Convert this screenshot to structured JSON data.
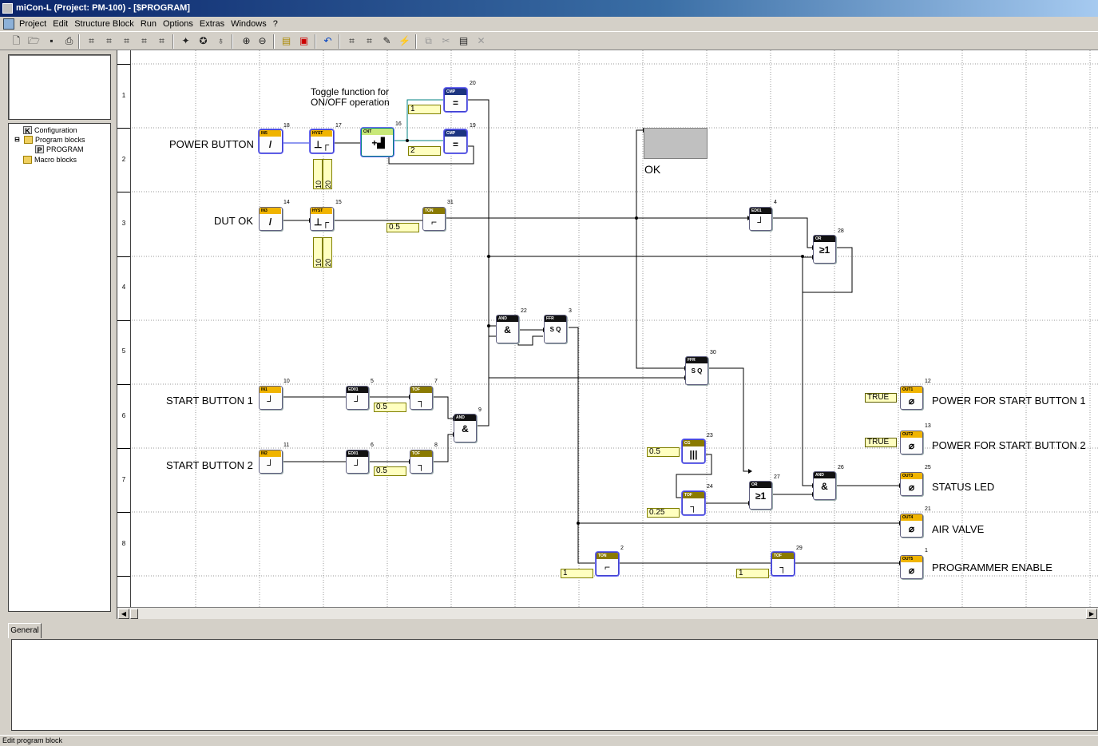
{
  "window": {
    "title": "miCon-L  (Project: PM-100)  - [$PROGRAM]"
  },
  "menu": [
    "Project",
    "Edit",
    "Structure Block",
    "Run",
    "Options",
    "Extras",
    "Windows",
    "?"
  ],
  "toolbar": {
    "icons": [
      "new-icon",
      "open-icon",
      "save-icon",
      "print-icon",
      "block-icon",
      "block-icon",
      "block-icon",
      "block-icon",
      "block-icon",
      "compile-icon",
      "download-icon",
      "bulb-icon",
      "zoom-in-icon",
      "zoom-out-icon",
      "cfg-icon",
      "stop-icon",
      "undo-icon",
      "select-icon",
      "link-icon",
      "pencil-icon",
      "wire-icon",
      "copy-icon",
      "cut-icon",
      "paste-icon",
      "delete-icon"
    ]
  },
  "tree": {
    "items": [
      {
        "label": "Configuration",
        "icon": "K"
      },
      {
        "label": "Program blocks",
        "icon": "folder"
      },
      {
        "label": "PROGRAM",
        "icon": "P"
      },
      {
        "label": "Macro blocks",
        "icon": "folder"
      }
    ]
  },
  "ruler": [
    "1",
    "2",
    "3",
    "4",
    "5",
    "6",
    "7",
    "8"
  ],
  "labels": {
    "toggle": "Toggle function for\nON/OFF operation",
    "power_button": "POWER BUTTON",
    "dut_ok": "DUT OK",
    "start1": "START BUTTON 1",
    "start2": "START BUTTON 2",
    "ok": "OK",
    "out1": "POWER FOR START BUTTON 1",
    "out2": "POWER FOR START BUTTON 2",
    "out3": "STATUS LED",
    "out4": "AIR VALVE",
    "out5": "PROGRAMMER ENABLE"
  },
  "blocks": [
    {
      "id": "in5",
      "type": "IN5",
      "num": "18",
      "sym": "/"
    },
    {
      "id": "hyst17",
      "type": "HYST",
      "num": "17",
      "sym": "⊥┌"
    },
    {
      "id": "cnt16",
      "type": "CNT",
      "num": "16",
      "sym": "+▟"
    },
    {
      "id": "cmp20",
      "type": "CMP",
      "num": "20",
      "sym": "="
    },
    {
      "id": "cmp19",
      "type": "CMP",
      "num": "19",
      "sym": "="
    },
    {
      "id": "in3",
      "type": "IN3",
      "num": "14",
      "sym": "/"
    },
    {
      "id": "hyst15",
      "type": "HYST",
      "num": "15",
      "sym": "⊥┌"
    },
    {
      "id": "ton31",
      "type": "TON",
      "num": "31",
      "sym": "⌐"
    },
    {
      "id": "ed4",
      "type": "ED01",
      "num": "4",
      "sym": "┘"
    },
    {
      "id": "or28",
      "type": "OR",
      "num": "28",
      "sym": "≥1"
    },
    {
      "id": "and22",
      "type": "AND",
      "num": "22",
      "sym": "&"
    },
    {
      "id": "ffr3",
      "type": "FFR",
      "num": "3",
      "sym": "S Q"
    },
    {
      "id": "ffr30",
      "type": "FFR",
      "num": "30",
      "sym": "S Q"
    },
    {
      "id": "in1",
      "type": "IN1",
      "num": "10",
      "sym": "┘"
    },
    {
      "id": "ed5",
      "type": "ED01",
      "num": "5",
      "sym": "┘"
    },
    {
      "id": "tof7",
      "type": "TOF",
      "num": "7",
      "sym": "┐"
    },
    {
      "id": "and9",
      "type": "AND",
      "num": "9",
      "sym": "&"
    },
    {
      "id": "in2",
      "type": "IN2",
      "num": "11",
      "sym": "┘"
    },
    {
      "id": "ed6",
      "type": "ED01",
      "num": "6",
      "sym": "┘"
    },
    {
      "id": "tof8",
      "type": "TOF",
      "num": "8",
      "sym": "┐"
    },
    {
      "id": "cg23",
      "type": "CG",
      "num": "23",
      "sym": "|||"
    },
    {
      "id": "tof24",
      "type": "TOF",
      "num": "24",
      "sym": "┐"
    },
    {
      "id": "or27",
      "type": "OR",
      "num": "27",
      "sym": "≥1"
    },
    {
      "id": "and26",
      "type": "AND",
      "num": "26",
      "sym": "&"
    },
    {
      "id": "ton2",
      "type": "TON",
      "num": "2",
      "sym": "⌐"
    },
    {
      "id": "tof29",
      "type": "TOF",
      "num": "29",
      "sym": "┐"
    },
    {
      "id": "out1",
      "type": "OUT1",
      "num": "12",
      "sym": "⌀"
    },
    {
      "id": "out2",
      "type": "OUT2",
      "num": "13",
      "sym": "⌀"
    },
    {
      "id": "out3",
      "type": "OUT3",
      "num": "25",
      "sym": "⌀"
    },
    {
      "id": "out4",
      "type": "OUT4",
      "num": "21",
      "sym": "⌀"
    },
    {
      "id": "out5",
      "type": "OUT5",
      "num": "1",
      "sym": "⌀"
    }
  ],
  "constants": {
    "c1": "1",
    "c2": "2",
    "ton31": "0.5",
    "tof7": "0.5",
    "tof8": "0.5",
    "cg23": "0.5",
    "tof24": "0.25",
    "ton2": "1",
    "tof29": "1",
    "true1": "TRUE",
    "true2": "TRUE",
    "h17a": "10",
    "h17b": "20",
    "h15a": "10",
    "h15b": "20"
  },
  "tabs": {
    "general": "General"
  },
  "status": {
    "text": "Edit program block"
  }
}
